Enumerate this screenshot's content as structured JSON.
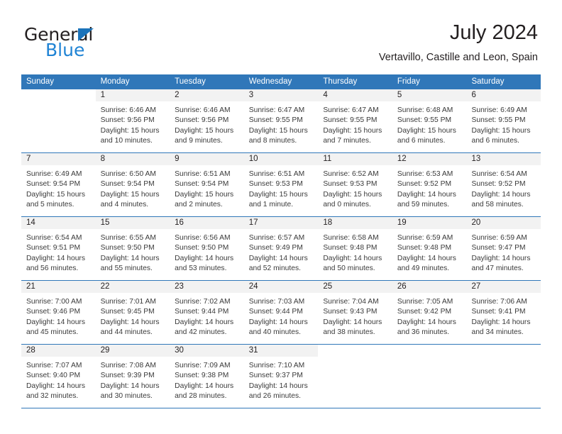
{
  "brand": {
    "name_top": "General",
    "name_bottom": "Blue",
    "accent_color": "#1f83d4",
    "triangle_color": "#1b73ba"
  },
  "header": {
    "title": "July 2024",
    "location": "Vertavillo, Castille and Leon, Spain"
  },
  "theme": {
    "header_bg": "#3077b9",
    "header_text": "#ffffff",
    "daynum_bg": "#f2f2f2",
    "row_separator": "#3077b9",
    "body_text": "#3a3a3a"
  },
  "weekdays": [
    "Sunday",
    "Monday",
    "Tuesday",
    "Wednesday",
    "Thursday",
    "Friday",
    "Saturday"
  ],
  "weeks": [
    [
      {
        "day": "",
        "blank": true,
        "lines": []
      },
      {
        "day": "1",
        "lines": [
          "Sunrise: 6:46 AM",
          "Sunset: 9:56 PM",
          "Daylight: 15 hours",
          "and 10 minutes."
        ]
      },
      {
        "day": "2",
        "lines": [
          "Sunrise: 6:46 AM",
          "Sunset: 9:56 PM",
          "Daylight: 15 hours",
          "and 9 minutes."
        ]
      },
      {
        "day": "3",
        "lines": [
          "Sunrise: 6:47 AM",
          "Sunset: 9:55 PM",
          "Daylight: 15 hours",
          "and 8 minutes."
        ]
      },
      {
        "day": "4",
        "lines": [
          "Sunrise: 6:47 AM",
          "Sunset: 9:55 PM",
          "Daylight: 15 hours",
          "and 7 minutes."
        ]
      },
      {
        "day": "5",
        "lines": [
          "Sunrise: 6:48 AM",
          "Sunset: 9:55 PM",
          "Daylight: 15 hours",
          "and 6 minutes."
        ]
      },
      {
        "day": "6",
        "lines": [
          "Sunrise: 6:49 AM",
          "Sunset: 9:55 PM",
          "Daylight: 15 hours",
          "and 6 minutes."
        ]
      }
    ],
    [
      {
        "day": "7",
        "lines": [
          "Sunrise: 6:49 AM",
          "Sunset: 9:54 PM",
          "Daylight: 15 hours",
          "and 5 minutes."
        ]
      },
      {
        "day": "8",
        "lines": [
          "Sunrise: 6:50 AM",
          "Sunset: 9:54 PM",
          "Daylight: 15 hours",
          "and 4 minutes."
        ]
      },
      {
        "day": "9",
        "lines": [
          "Sunrise: 6:51 AM",
          "Sunset: 9:54 PM",
          "Daylight: 15 hours",
          "and 2 minutes."
        ]
      },
      {
        "day": "10",
        "lines": [
          "Sunrise: 6:51 AM",
          "Sunset: 9:53 PM",
          "Daylight: 15 hours",
          "and 1 minute."
        ]
      },
      {
        "day": "11",
        "lines": [
          "Sunrise: 6:52 AM",
          "Sunset: 9:53 PM",
          "Daylight: 15 hours",
          "and 0 minutes."
        ]
      },
      {
        "day": "12",
        "lines": [
          "Sunrise: 6:53 AM",
          "Sunset: 9:52 PM",
          "Daylight: 14 hours",
          "and 59 minutes."
        ]
      },
      {
        "day": "13",
        "lines": [
          "Sunrise: 6:54 AM",
          "Sunset: 9:52 PM",
          "Daylight: 14 hours",
          "and 58 minutes."
        ]
      }
    ],
    [
      {
        "day": "14",
        "lines": [
          "Sunrise: 6:54 AM",
          "Sunset: 9:51 PM",
          "Daylight: 14 hours",
          "and 56 minutes."
        ]
      },
      {
        "day": "15",
        "lines": [
          "Sunrise: 6:55 AM",
          "Sunset: 9:50 PM",
          "Daylight: 14 hours",
          "and 55 minutes."
        ]
      },
      {
        "day": "16",
        "lines": [
          "Sunrise: 6:56 AM",
          "Sunset: 9:50 PM",
          "Daylight: 14 hours",
          "and 53 minutes."
        ]
      },
      {
        "day": "17",
        "lines": [
          "Sunrise: 6:57 AM",
          "Sunset: 9:49 PM",
          "Daylight: 14 hours",
          "and 52 minutes."
        ]
      },
      {
        "day": "18",
        "lines": [
          "Sunrise: 6:58 AM",
          "Sunset: 9:48 PM",
          "Daylight: 14 hours",
          "and 50 minutes."
        ]
      },
      {
        "day": "19",
        "lines": [
          "Sunrise: 6:59 AM",
          "Sunset: 9:48 PM",
          "Daylight: 14 hours",
          "and 49 minutes."
        ]
      },
      {
        "day": "20",
        "lines": [
          "Sunrise: 6:59 AM",
          "Sunset: 9:47 PM",
          "Daylight: 14 hours",
          "and 47 minutes."
        ]
      }
    ],
    [
      {
        "day": "21",
        "lines": [
          "Sunrise: 7:00 AM",
          "Sunset: 9:46 PM",
          "Daylight: 14 hours",
          "and 45 minutes."
        ]
      },
      {
        "day": "22",
        "lines": [
          "Sunrise: 7:01 AM",
          "Sunset: 9:45 PM",
          "Daylight: 14 hours",
          "and 44 minutes."
        ]
      },
      {
        "day": "23",
        "lines": [
          "Sunrise: 7:02 AM",
          "Sunset: 9:44 PM",
          "Daylight: 14 hours",
          "and 42 minutes."
        ]
      },
      {
        "day": "24",
        "lines": [
          "Sunrise: 7:03 AM",
          "Sunset: 9:44 PM",
          "Daylight: 14 hours",
          "and 40 minutes."
        ]
      },
      {
        "day": "25",
        "lines": [
          "Sunrise: 7:04 AM",
          "Sunset: 9:43 PM",
          "Daylight: 14 hours",
          "and 38 minutes."
        ]
      },
      {
        "day": "26",
        "lines": [
          "Sunrise: 7:05 AM",
          "Sunset: 9:42 PM",
          "Daylight: 14 hours",
          "and 36 minutes."
        ]
      },
      {
        "day": "27",
        "lines": [
          "Sunrise: 7:06 AM",
          "Sunset: 9:41 PM",
          "Daylight: 14 hours",
          "and 34 minutes."
        ]
      }
    ],
    [
      {
        "day": "28",
        "lines": [
          "Sunrise: 7:07 AM",
          "Sunset: 9:40 PM",
          "Daylight: 14 hours",
          "and 32 minutes."
        ]
      },
      {
        "day": "29",
        "lines": [
          "Sunrise: 7:08 AM",
          "Sunset: 9:39 PM",
          "Daylight: 14 hours",
          "and 30 minutes."
        ]
      },
      {
        "day": "30",
        "lines": [
          "Sunrise: 7:09 AM",
          "Sunset: 9:38 PM",
          "Daylight: 14 hours",
          "and 28 minutes."
        ]
      },
      {
        "day": "31",
        "lines": [
          "Sunrise: 7:10 AM",
          "Sunset: 9:37 PM",
          "Daylight: 14 hours",
          "and 26 minutes."
        ]
      },
      {
        "day": "",
        "blank": true,
        "lines": []
      },
      {
        "day": "",
        "blank": true,
        "lines": []
      },
      {
        "day": "",
        "blank": true,
        "lines": []
      }
    ]
  ]
}
